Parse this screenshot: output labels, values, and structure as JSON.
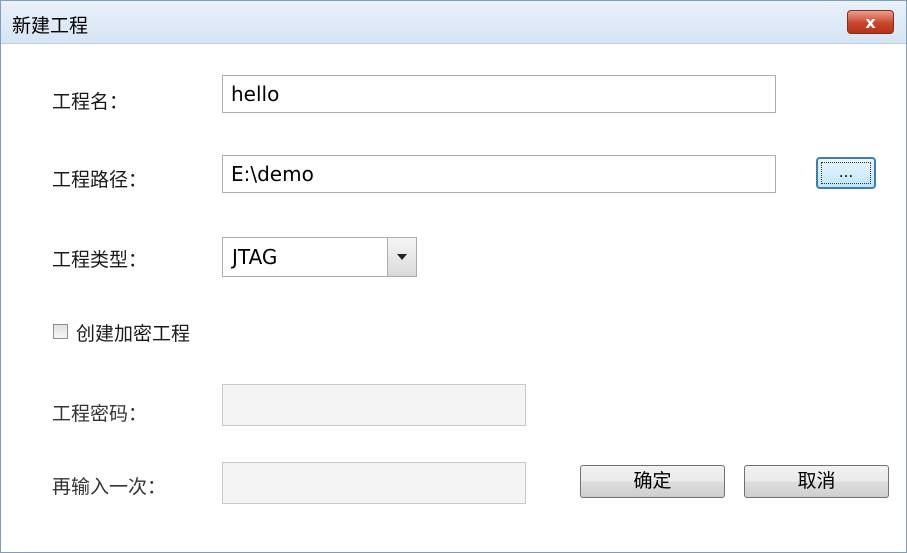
{
  "window": {
    "title": "新建工程",
    "close_label": "x"
  },
  "form": {
    "project_name_label": "工程名：",
    "project_name_value": "hello",
    "project_path_label": "工程路径：",
    "project_path_value": "E:\\demo",
    "browse_label": "...",
    "project_type_label": "工程类型：",
    "project_type_value": "JTAG",
    "encrypt_checkbox_label": "创建加密工程",
    "encrypt_checked": false,
    "password_label": "工程密码：",
    "password_value": "",
    "confirm_password_label": "再输入一次：",
    "confirm_password_value": ""
  },
  "buttons": {
    "ok_label": "确定",
    "cancel_label": "取消"
  }
}
